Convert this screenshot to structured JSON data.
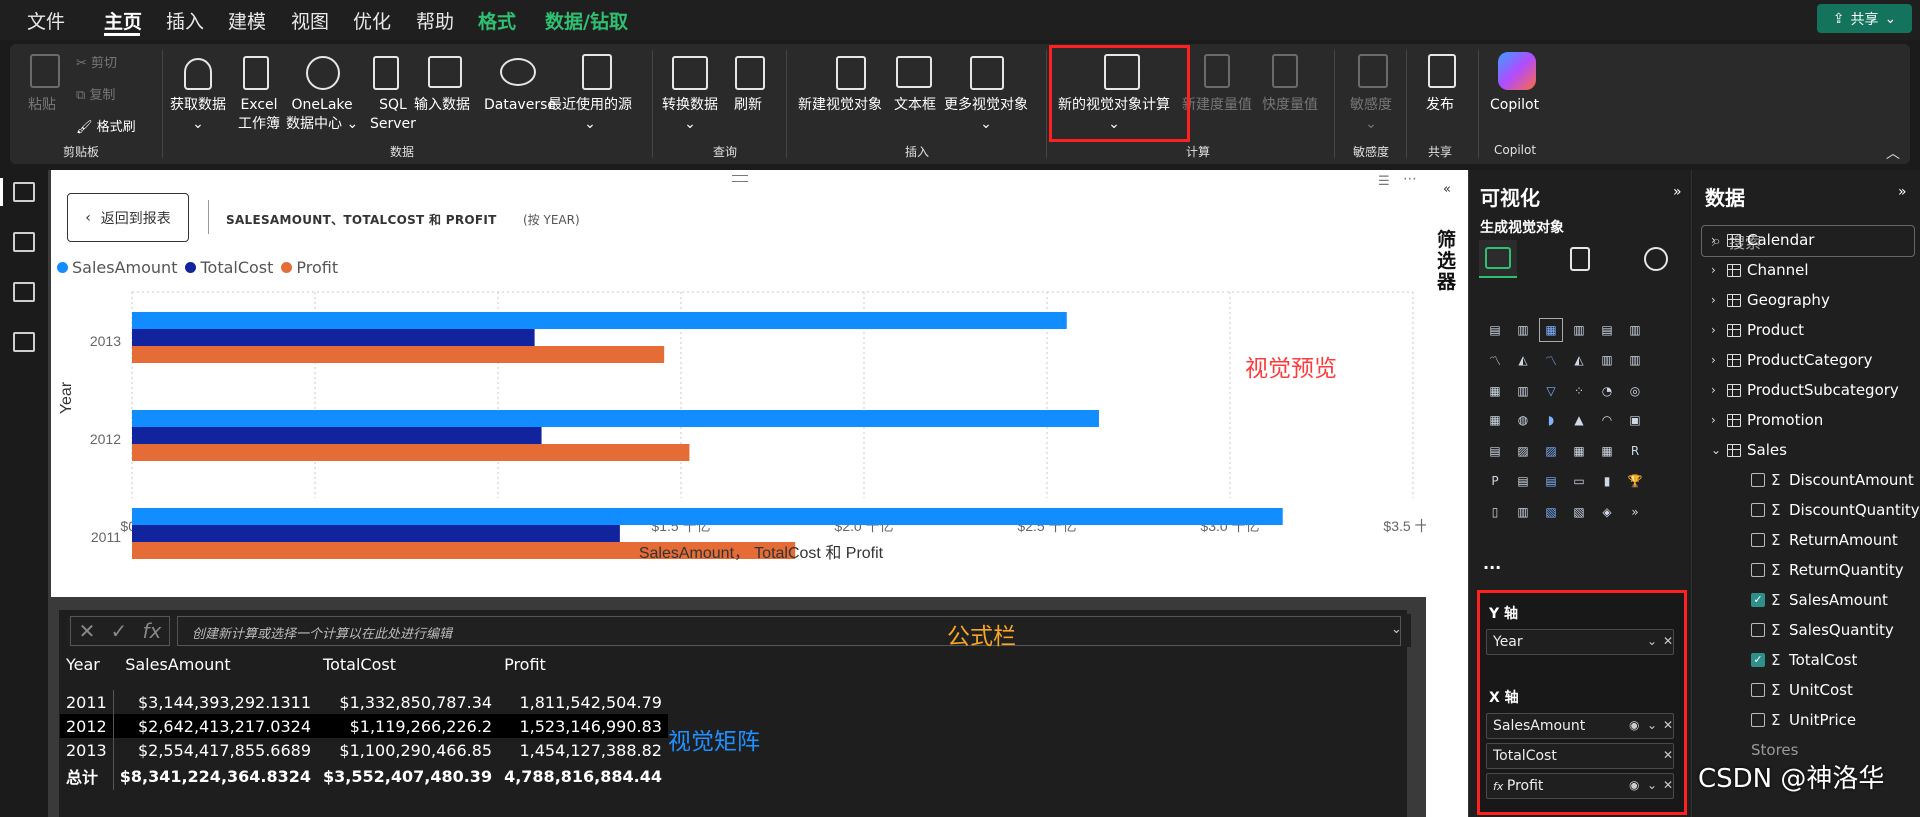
{
  "menu": {
    "items": [
      {
        "label": "文件"
      },
      {
        "label": "主页",
        "active": true
      },
      {
        "label": "插入"
      },
      {
        "label": "建模"
      },
      {
        "label": "视图"
      },
      {
        "label": "优化"
      },
      {
        "label": "帮助"
      },
      {
        "label": "格式",
        "contextual": true
      },
      {
        "label": "数据/钻取",
        "contextual": true
      }
    ],
    "share_label": "共享",
    "context_color": "#2fbf71"
  },
  "ribbon": {
    "clipboard": {
      "paste": "粘贴",
      "cut": "剪切",
      "copy": "复制",
      "format_painter": "格式刷",
      "group": "剪贴板"
    },
    "data": {
      "get_data": "获取数据",
      "excel": "Excel",
      "excel2": "工作簿",
      "onelake": "OneLake",
      "onelake2": "数据中心",
      "sql": "SQL",
      "sql2": "Server",
      "enter_data": "输入数据",
      "dataverse": "Dataverse",
      "recent": "最近使用的源",
      "group": "数据"
    },
    "query": {
      "transform": "转换数据",
      "refresh": "刷新",
      "group": "查询"
    },
    "insert": {
      "new_visual": "新建视觉对象",
      "textbox": "文本框",
      "more_visuals": "更多视觉对象",
      "group": "插入"
    },
    "calc": {
      "new_visual_calc": "新的视觉对象计算",
      "new_measure": "新建度量值",
      "quick_measure": "快度量值",
      "group": "计算"
    },
    "sensitivity": {
      "label": "敏感度",
      "group": "敏感度"
    },
    "share": {
      "publish": "发布",
      "group": "共享"
    },
    "copilot": {
      "label": "Copilot",
      "group": "Copilot"
    }
  },
  "visual_header": {
    "back_label": "返回到报表",
    "title": "SALESAMOUNT、TOTALCOST 和 PROFIT",
    "subtitle": "(按 YEAR)"
  },
  "chart_data": {
    "type": "bar",
    "orientation": "horizontal",
    "categories": [
      "2013",
      "2012",
      "2011"
    ],
    "series": [
      {
        "name": "SalesAmount",
        "values": [
          2.554,
          2.642,
          3.144
        ],
        "color": "#118dff"
      },
      {
        "name": "TotalCost",
        "values": [
          1.1,
          1.119,
          1.333
        ],
        "color": "#12239e"
      },
      {
        "name": "Profit",
        "values": [
          1.454,
          1.523,
          1.812
        ],
        "color": "#e66c37"
      }
    ],
    "x_ticks": [
      "$0.0 十亿",
      "$0.5 十亿",
      "$1.0 十亿",
      "$1.5 十亿",
      "$2.0 十亿",
      "$2.5 十亿",
      "$3.0 十亿",
      "$3.5 十亿"
    ],
    "xlim": [
      0,
      3.5
    ],
    "xlabel": "SalesAmount， TotalCost 和 Profit",
    "ylabel": "Year",
    "grid": true,
    "legend_position": "top-left"
  },
  "annotations": {
    "preview": "视觉预览",
    "formula": "公式栏",
    "matrix": "视觉矩阵"
  },
  "formula_bar": {
    "placeholder": "创建新计算或选择一个计算以在此处进行编辑"
  },
  "matrix": {
    "headers": [
      "Year",
      "SalesAmount",
      "TotalCost",
      "Profit"
    ],
    "rows": [
      [
        "2011",
        "$3,144,393,292.1311",
        "$1,332,850,787.34",
        "1,811,542,504.79"
      ],
      [
        "2012",
        "$2,642,413,217.0324",
        "$1,119,266,226.2",
        "1,523,146,990.83"
      ],
      [
        "2013",
        "$2,554,417,855.6689",
        "$1,100,290,466.85",
        "1,454,127,388.82"
      ]
    ],
    "total": [
      "总计",
      "$8,341,224,364.8324",
      "$3,552,407,480.39",
      "4,788,816,884.44"
    ]
  },
  "filters_label": "筛选器",
  "viz_pane": {
    "title": "可视化",
    "subtitle": "生成视觉对象",
    "more": "...",
    "y_axis_label": "Y 轴",
    "x_axis_label": "X 轴",
    "y_fields": [
      "Year"
    ],
    "x_fields": [
      "SalesAmount",
      "TotalCost",
      "Profit"
    ]
  },
  "data_pane": {
    "title": "数据",
    "search_placeholder": "搜索",
    "tables": [
      "Calendar",
      "Channel",
      "Geography",
      "Product",
      "ProductCategory",
      "ProductSubcategory",
      "Promotion",
      "Sales"
    ],
    "sales_fields": [
      {
        "name": "DiscountAmount",
        "checked": false
      },
      {
        "name": "DiscountQuantity",
        "checked": false
      },
      {
        "name": "ReturnAmount",
        "checked": false
      },
      {
        "name": "ReturnQuantity",
        "checked": false
      },
      {
        "name": "SalesAmount",
        "checked": true
      },
      {
        "name": "SalesQuantity",
        "checked": false
      },
      {
        "name": "TotalCost",
        "checked": true
      },
      {
        "name": "UnitCost",
        "checked": false
      },
      {
        "name": "UnitPrice",
        "checked": false
      }
    ],
    "partial_table": "Stores"
  },
  "watermark": "CSDN @神洛华"
}
